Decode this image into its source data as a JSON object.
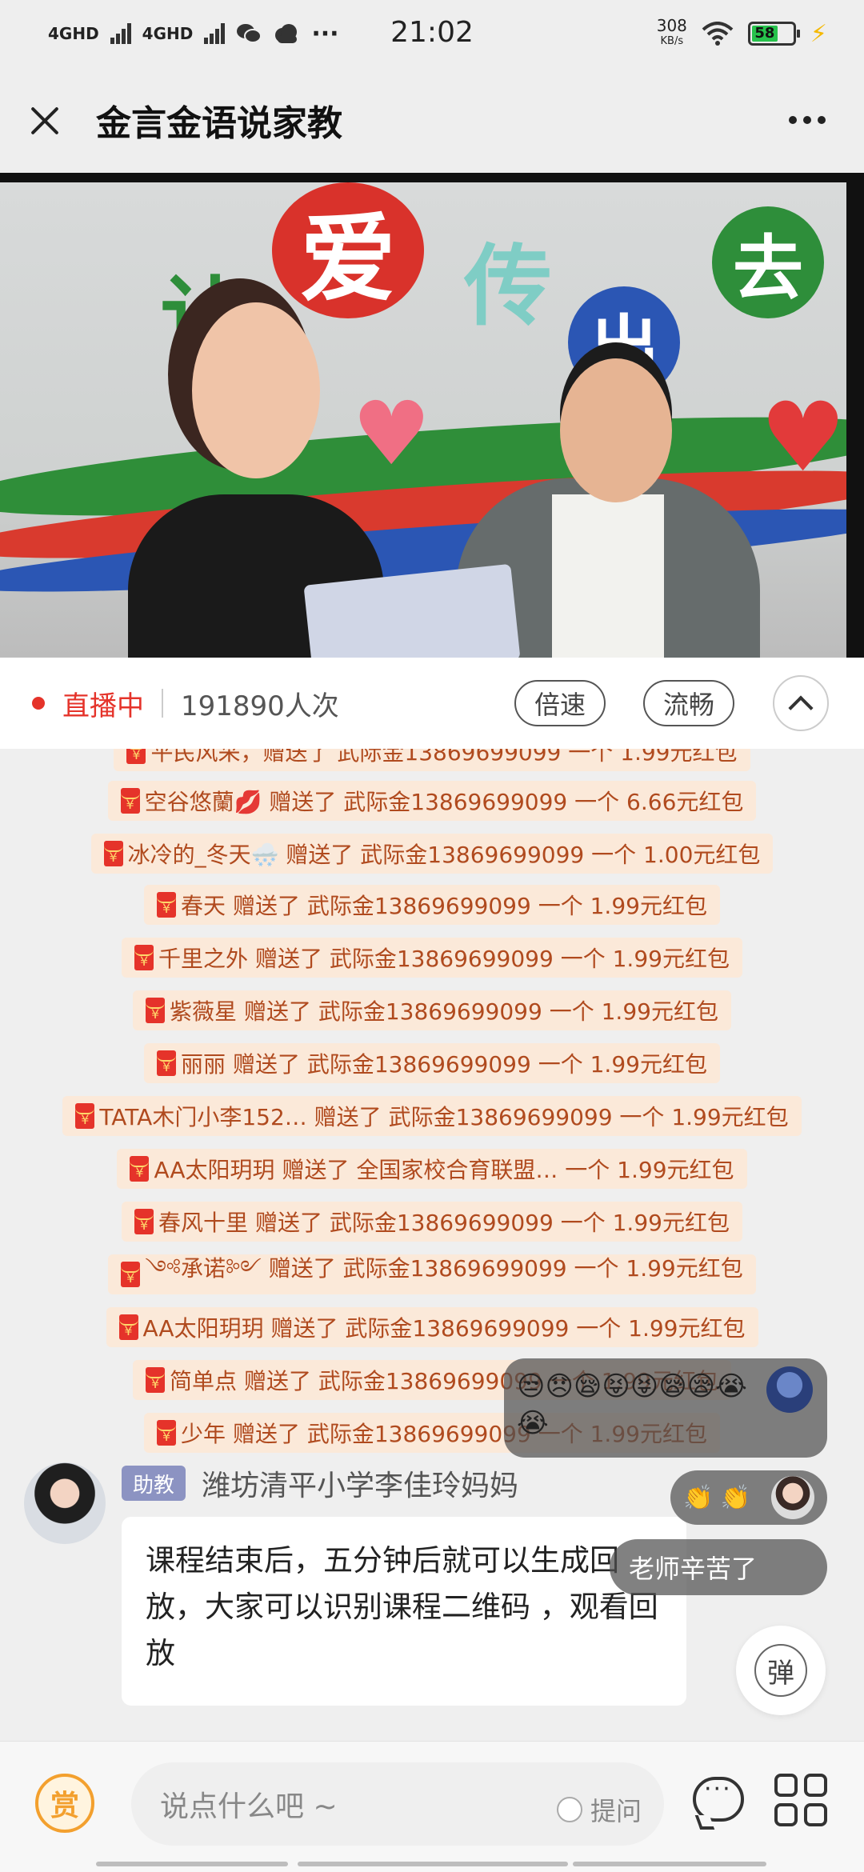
{
  "status_bar": {
    "network_1": "4GHD",
    "network_2": "4GHD",
    "time": "21:02",
    "speed_value": "308",
    "speed_unit": "KB/s",
    "battery": "58",
    "icons": [
      "signal-icon",
      "wechat-icon",
      "cloud-icon",
      "more-dots-icon",
      "wifi-icon",
      "battery-icon",
      "charging-icon"
    ]
  },
  "header": {
    "title": "金言金语说家教",
    "close_icon": "close-icon",
    "more_icon": "more-icon"
  },
  "live": {
    "status": "直播中",
    "viewers": "191890人次",
    "speed_label": "倍速",
    "quality_label": "流畅"
  },
  "video_wall_text": [
    "让",
    "爱",
    "传",
    "出",
    "去"
  ],
  "red_packets": [
    {
      "text": "空谷悠蘭💋 赠送了 武际金13869699099 一个 6.66元红包"
    },
    {
      "text": "冰冷的_冬天🌨️ 赠送了 武际金13869699099 一个 1.00元红包"
    },
    {
      "text": "春天 赠送了 武际金13869699099 一个 1.99元红包"
    },
    {
      "text": "千里之外 赠送了 武际金13869699099 一个 1.99元红包"
    },
    {
      "text": "紫薇星 赠送了 武际金13869699099 一个 1.99元红包"
    },
    {
      "text": "丽丽 赠送了 武际金13869699099 一个 1.99元红包"
    },
    {
      "text": "TATA木门小李152… 赠送了 武际金13869699099 一个 1.99元红包"
    },
    {
      "text": "AA太阳玥玥 赠送了 全国家校合育联盟… 一个 1.99元红包"
    },
    {
      "text": "春风十里 赠送了 武际金13869699099 一个 1.99元红包"
    },
    {
      "text": "༺承诺༻ 赠送了 武际金13869699099 一个 1.99元红包"
    },
    {
      "text": "AA太阳玥玥 赠送了 武际金13869699099 一个 1.99元红包"
    },
    {
      "text": "简单点 赠送了 武际金13869699099 一个 1.99元红包"
    },
    {
      "text": "少年 赠送了 武际金13869699099 一个 1.99元红包"
    }
  ],
  "assistant_message": {
    "role": "助教",
    "sender": "潍坊清平小学李佳玲妈妈",
    "text": "课程结束后，五分钟后就可以生成回放，大家可以识别课程二维码 ，观看回放"
  },
  "floating_comments": {
    "emoji_comment": "😒😞😪😝😝😪😪😭😭",
    "clap_comment": "👏 👏",
    "text_comment": "老师辛苦了"
  },
  "danmu_label": "弹",
  "bottom_bar": {
    "reward_label": "赏",
    "input_placeholder": "说点什么吧 ~",
    "ask_label": "提问"
  }
}
